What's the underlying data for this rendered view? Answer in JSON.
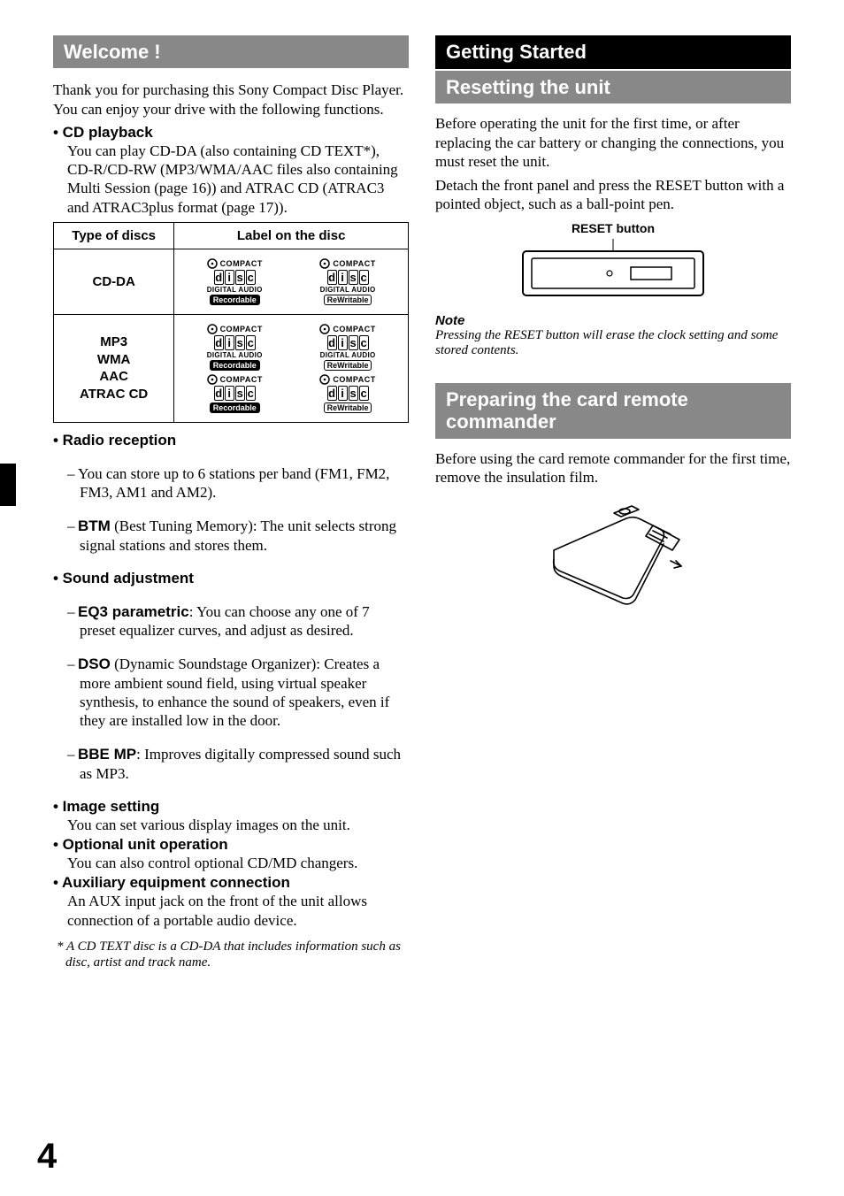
{
  "page_number": "4",
  "left": {
    "h1": "Welcome !",
    "intro": "Thank you for purchasing this Sony Compact Disc Player. You can enjoy your drive with the following functions.",
    "cd_playback_head": "• CD playback",
    "cd_playback_body": "You can play CD-DA (also containing CD TEXT*), CD-R/CD-RW (MP3/WMA/AAC files also containing Multi Session (page 16)) and ATRAC CD (ATRAC3 and ATRAC3plus format (page 17)).",
    "table": {
      "col1": "Type of discs",
      "col2": "Label on the disc",
      "row1_type": "CD-DA",
      "row2_type_l1": "MP3",
      "row2_type_l2": "WMA",
      "row2_type_l3": "AAC",
      "row2_type_l4": "ATRAC CD",
      "logo_compact": "COMPACT",
      "logo_digital": "DIGITAL AUDIO",
      "logo_recordable": "Recordable",
      "logo_rewritable": "ReWritable"
    },
    "radio_head": "• Radio reception",
    "radio_item1": "You can store up to 6 stations per band (FM1, FM2, FM3, AM1 and AM2).",
    "radio_item2_bold": "BTM",
    "radio_item2_rest": " (Best Tuning Memory): The unit selects strong signal stations and stores them.",
    "sound_head": "• Sound adjustment",
    "sound_item1_bold": "EQ3 parametric",
    "sound_item1_rest": ": You can choose any one of 7 preset equalizer curves, and adjust as desired.",
    "sound_item2_bold": "DSO",
    "sound_item2_rest": " (Dynamic Soundstage Organizer): Creates a more ambient sound field, using virtual speaker synthesis, to enhance the sound of speakers, even if they are installed low in the door.",
    "sound_item3_bold": "BBE MP",
    "sound_item3_rest": ": Improves digitally compressed sound such as MP3.",
    "image_head": "• Image setting",
    "image_body": "You can set various display images on the unit.",
    "optional_head": "• Optional unit operation",
    "optional_body": "You can also control optional CD/MD changers.",
    "aux_head": "• Auxiliary equipment connection",
    "aux_body": "An AUX input jack on the front of the unit allows connection of a portable audio device.",
    "footnote": "* A CD TEXT disc is a CD-DA that includes information such as disc, artist and track name."
  },
  "right": {
    "chapter": "Getting Started",
    "h2_reset": "Resetting the unit",
    "reset_body1": "Before operating the unit for the first time, or after replacing the car battery or changing the connections, you must reset the unit.",
    "reset_body2": "Detach the front panel and press the RESET button with a pointed object, such as a ball-point pen.",
    "reset_label": "RESET button",
    "note_head": "Note",
    "note_body": "Pressing the RESET button will erase the clock setting and some stored contents.",
    "h2_prepare": "Preparing the card remote commander",
    "prepare_body": "Before using the card remote commander for the first time, remove the insulation film."
  }
}
